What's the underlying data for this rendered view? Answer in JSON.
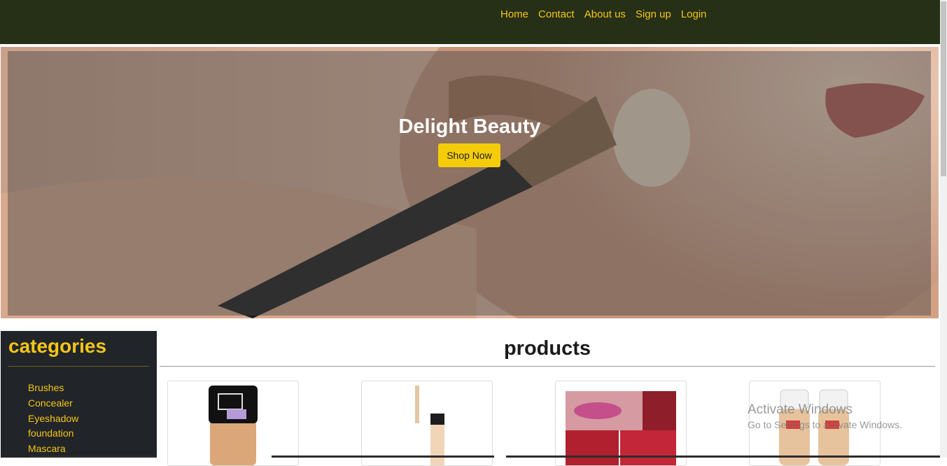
{
  "nav": {
    "items": [
      "Home",
      "Contact",
      "About us",
      "Sign up",
      "Login"
    ]
  },
  "hero": {
    "title": "Delight Beauty",
    "button_label": "Shop Now"
  },
  "sidebar": {
    "title": "categories",
    "items": [
      "Brushes",
      "Concealer",
      "Eyeshadow",
      "foundation",
      "Mascara"
    ]
  },
  "products": {
    "title": "products",
    "items": [
      {
        "image": "foundation-bottle"
      },
      {
        "image": "concealer-wand"
      },
      {
        "image": "eyeshadow-palette"
      },
      {
        "image": "foundation-bottles"
      }
    ]
  },
  "watermark": {
    "line1": "Activate Windows",
    "line2": "Go to Settings to activate Windows."
  },
  "colors": {
    "nav_bg": "#263016",
    "accent": "#f5c518",
    "sidebar_bg": "#212529",
    "button_bg": "#f5cc0a"
  }
}
